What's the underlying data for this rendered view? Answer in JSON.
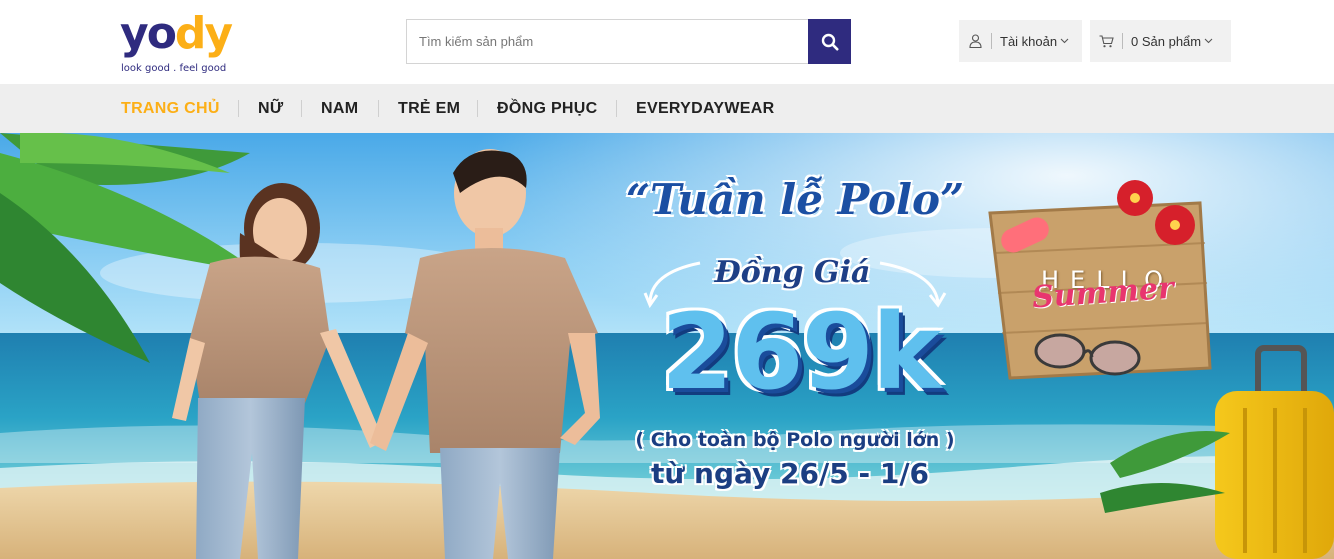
{
  "logo": {
    "letters": [
      "y",
      "o",
      "d",
      "y"
    ],
    "tagline": "look good . feel good"
  },
  "search": {
    "placeholder": "Tìm kiếm sản phẩm",
    "value": "",
    "icon": "search-icon"
  },
  "account": {
    "label": "Tài khoản",
    "icon": "user-icon"
  },
  "cart": {
    "label": "0 Sản phẩm",
    "icon": "cart-icon"
  },
  "nav": {
    "items": [
      {
        "label": "TRANG CHỦ",
        "active": true
      },
      {
        "label": "NỮ",
        "active": false
      },
      {
        "label": "NAM",
        "active": false
      },
      {
        "label": "TRẺ EM",
        "active": false
      },
      {
        "label": "ĐỒNG PHỤC",
        "active": false
      },
      {
        "label": "EVERYDAYWEAR",
        "active": false
      }
    ]
  },
  "banner": {
    "title": "“Tuần lễ Polo”",
    "subtitle": "Đồng Giá",
    "price": "269k",
    "note": "( Cho toàn bộ Polo người lớn )",
    "dates": "từ ngày 26/5 - 1/6",
    "sign_hello": "HELLO",
    "sign_summer": "Summer"
  },
  "colors": {
    "brand_navy": "#2f2b7f",
    "brand_yellow": "#fcaf17",
    "nav_bg": "#eeeeee"
  }
}
